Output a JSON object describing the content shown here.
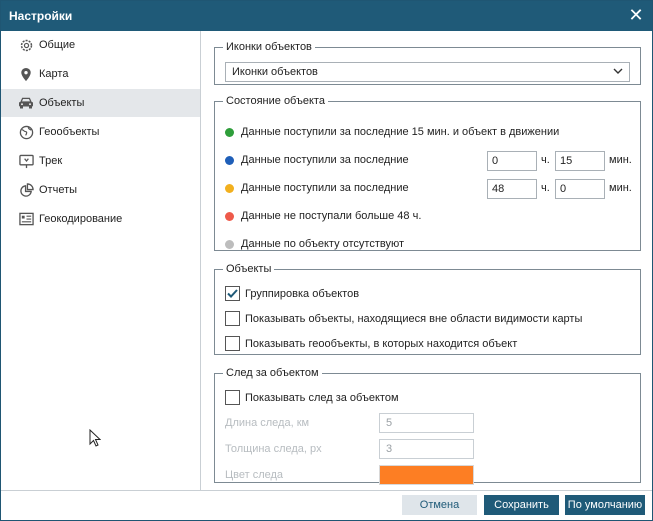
{
  "dialog": {
    "title": "Настройки"
  },
  "sidebar": {
    "items": [
      {
        "label": "Общие",
        "icon": "gear-icon"
      },
      {
        "label": "Карта",
        "icon": "map-pin-icon"
      },
      {
        "label": "Объекты",
        "icon": "car-icon",
        "active": true
      },
      {
        "label": "Геообъекты",
        "icon": "globe-icon"
      },
      {
        "label": "Трек",
        "icon": "track-icon"
      },
      {
        "label": "Отчеты",
        "icon": "pie-chart-icon"
      },
      {
        "label": "Геокодирование",
        "icon": "address-card-icon"
      }
    ]
  },
  "icons_section": {
    "legend": "Иконки объектов",
    "select_value": "Иконки объектов"
  },
  "state_section": {
    "legend": "Состояние объекта",
    "rows": [
      {
        "text": "Данные поступили за последние 15 мин. и объект в движении",
        "color": "#2e9e3a"
      },
      {
        "text": "Данные поступили за последние",
        "color": "#1f5fb8",
        "hours": "0",
        "minutes": "15"
      },
      {
        "text": "Данные поступили за последние",
        "color": "#f2b01e",
        "hours": "48",
        "minutes": "0"
      },
      {
        "text": "Данные не поступали больше 48 ч.",
        "color": "#ee5a4a"
      },
      {
        "text": "Данные по объекту отсутствуют",
        "color": "#bdbdbd"
      }
    ],
    "hours_unit": "ч.",
    "minutes_unit": "мин."
  },
  "objects_section": {
    "legend": "Объекты",
    "checkboxes": [
      {
        "label": "Группировка объектов",
        "checked": true
      },
      {
        "label": "Показывать объекты, находящиеся вне области видимости карты",
        "checked": false
      },
      {
        "label": "Показывать геообъекты, в которых находится объект",
        "checked": false
      }
    ]
  },
  "trail_section": {
    "legend": "След за объектом",
    "show_label": "Показывать след за объектом",
    "show_checked": false,
    "length_label": "Длина следа, км",
    "length_value": "5",
    "width_label": "Толщина следа, px",
    "width_value": "3",
    "color_label": "Цвет следа",
    "color_value": "#fd7e23"
  },
  "footer": {
    "cancel": "Отмена",
    "save": "Сохранить",
    "default": "По умолчанию"
  },
  "colors": {
    "accent": "#1f5a78"
  }
}
